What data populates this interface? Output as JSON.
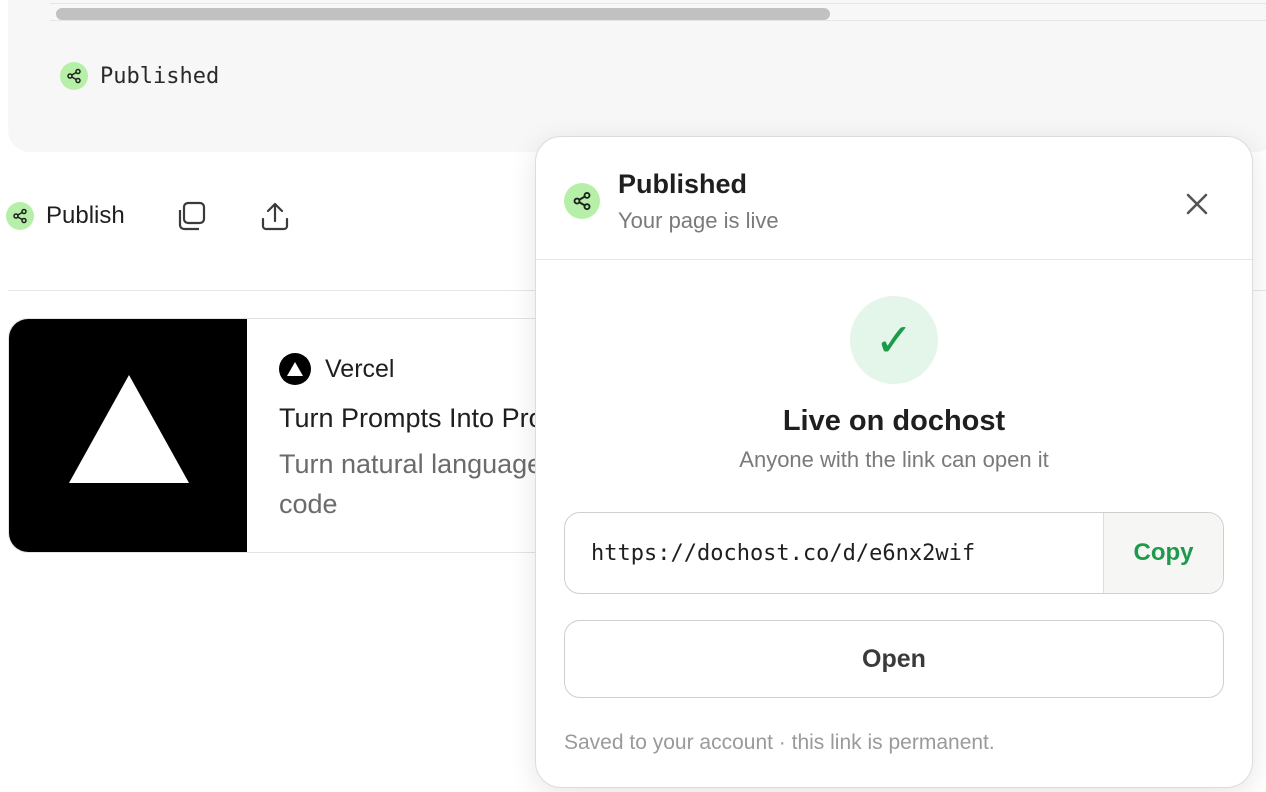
{
  "code_block": {
    "status_label": "Published"
  },
  "action_row": {
    "publish_label": "Publish",
    "icons": [
      "share-icon",
      "copy-icon",
      "upload-icon"
    ]
  },
  "preview": {
    "brand": "Vercel",
    "title": "Turn Prompts Into Production Apps",
    "description": "Turn natural language into production-ready React and Tailwind code"
  },
  "popover": {
    "title": "Published",
    "subtitle": "Your page is live",
    "check_glyph": "✓",
    "live_title": "Live on dochost",
    "live_subtitle": "Anyone with the link can open it",
    "url": "https://dochost.co/d/e6nx2wif",
    "copy_label": "Copy",
    "open_label": "Open",
    "footer": "Saved to your account · this link is permanent."
  },
  "colors": {
    "accent_green": "#1e9a4c",
    "share_badge": "#b6f0a8",
    "check_bg": "#e4f6ea"
  }
}
